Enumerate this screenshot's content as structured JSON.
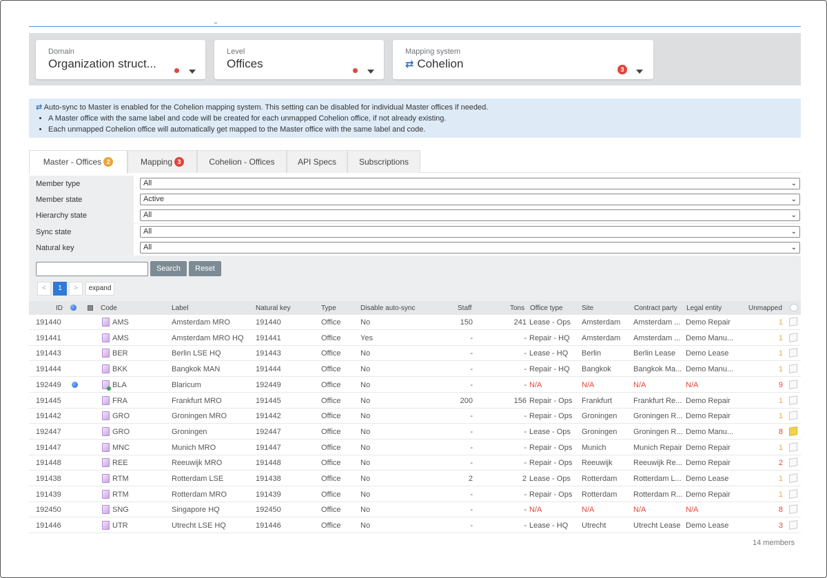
{
  "selectors": {
    "domain": {
      "label": "Domain",
      "value": "Organization struct..."
    },
    "level": {
      "label": "Level",
      "value": "Offices"
    },
    "mapping_system": {
      "label": "Mapping system",
      "value": "Cohelion",
      "badge": "3",
      "icon": "sync-icon"
    }
  },
  "info": {
    "line1": "Auto-sync to Master is enabled for the Cohelion mapping system. This setting can be disabled for individual Master offices if needed.",
    "bullets": [
      "A Master office with the same label and code will be created for each unmapped Cohelion office, if not already existing.",
      "Each unmapped Cohelion office will automatically get mapped to the Master office with the same label and code."
    ]
  },
  "tabs": [
    {
      "label": "Master - Offices",
      "badge": "2",
      "badge_color": "#e9a63c"
    },
    {
      "label": "Mapping",
      "badge": "3",
      "badge_color": "#e0453c"
    },
    {
      "label": "Cohelion - Offices"
    },
    {
      "label": "API Specs"
    },
    {
      "label": "Subscriptions"
    }
  ],
  "filters": [
    {
      "label": "Member type",
      "value": "All"
    },
    {
      "label": "Member state",
      "value": "Active"
    },
    {
      "label": "Hierarchy state",
      "value": "All"
    },
    {
      "label": "Sync state",
      "value": "All"
    },
    {
      "label": "Natural key",
      "value": "All"
    }
  ],
  "search": {
    "placeholder": "",
    "search_label": "Search",
    "reset_label": "Reset"
  },
  "pager": {
    "prev": "<",
    "page": "1",
    "next": ">",
    "expand": "expand"
  },
  "table": {
    "headers": {
      "id": "ID",
      "code": "Code",
      "label": "Label",
      "natural_key": "Natural key",
      "type": "Type",
      "disable_auto_sync": "Disable auto-sync",
      "staff": "Staff",
      "tons": "Tons",
      "office_type": "Office type",
      "site": "Site",
      "contract_party": "Contract party",
      "legal_entity": "Legal entity",
      "unmapped": "Unmapped"
    },
    "rows": [
      {
        "id": "191440",
        "code": "AMS",
        "label": "Amsterdam MRO",
        "natural_key": "191440",
        "type": "Office",
        "disable": "No",
        "staff": "150",
        "tons": "241",
        "office_type": "Lease - Ops",
        "site": "Amsterdam",
        "contract": "Amsterdam ...",
        "legal": "Demo Repair",
        "unmapped": "1"
      },
      {
        "id": "191441",
        "code": "AMS",
        "label": "Amsterdam MRO HQ",
        "natural_key": "191441",
        "type": "Office",
        "disable": "Yes",
        "staff": "-",
        "tons": "-",
        "office_type": "Repair - HQ",
        "site": "Amsterdam",
        "contract": "Amsterdam ...",
        "legal": "Demo Manu...",
        "unmapped": "1"
      },
      {
        "id": "191443",
        "code": "BER",
        "label": "Berlin LSE HQ",
        "natural_key": "191443",
        "type": "Office",
        "disable": "No",
        "staff": "-",
        "tons": "-",
        "office_type": "Lease - HQ",
        "site": "Berlin",
        "contract": "Berlin Lease",
        "legal": "Demo Lease",
        "unmapped": "1"
      },
      {
        "id": "191444",
        "code": "BKK",
        "label": "Bangkok MAN",
        "natural_key": "191444",
        "type": "Office",
        "disable": "No",
        "staff": "-",
        "tons": "-",
        "office_type": "Repair - HQ",
        "site": "Bangkok",
        "contract": "Bangkok Ma...",
        "legal": "Demo Manu...",
        "unmapped": "1"
      },
      {
        "id": "192449",
        "code": "BLA",
        "label": "Blaricum",
        "natural_key": "192449",
        "type": "Office",
        "disable": "No",
        "staff": "-",
        "tons": "-",
        "office_type": "N/A",
        "site": "N/A",
        "contract": "N/A",
        "legal": "N/A",
        "unmapped": "9",
        "blue_dot": true,
        "green": true,
        "na": true
      },
      {
        "id": "191445",
        "code": "FRA",
        "label": "Frankfurt MRO",
        "natural_key": "191445",
        "type": "Office",
        "disable": "No",
        "staff": "200",
        "tons": "156",
        "office_type": "Repair - Ops",
        "site": "Frankfurt",
        "contract": "Frankfurt Re...",
        "legal": "Demo Repair",
        "unmapped": "1"
      },
      {
        "id": "191442",
        "code": "GRO",
        "label": "Groningen MRO",
        "natural_key": "191442",
        "type": "Office",
        "disable": "No",
        "staff": "-",
        "tons": "-",
        "office_type": "Repair - Ops",
        "site": "Groningen",
        "contract": "Groningen R...",
        "legal": "Demo Repair",
        "unmapped": "1"
      },
      {
        "id": "192447",
        "code": "GRO",
        "label": "Groningen",
        "natural_key": "192447",
        "type": "Office",
        "disable": "No",
        "staff": "-",
        "tons": "-",
        "office_type": "Lease - Ops",
        "site": "Groningen",
        "contract": "Groningen R...",
        "legal": "Demo Manu...",
        "unmapped": "8",
        "note_filled": true
      },
      {
        "id": "191447",
        "code": "MNC",
        "label": "Munich MRO",
        "natural_key": "191447",
        "type": "Office",
        "disable": "No",
        "staff": "-",
        "tons": "-",
        "office_type": "Repair - Ops",
        "site": "Munich",
        "contract": "Munich Repair",
        "legal": "Demo Repair",
        "unmapped": "1"
      },
      {
        "id": "191448",
        "code": "REE",
        "label": "Reeuwijk MRO",
        "natural_key": "191448",
        "type": "Office",
        "disable": "No",
        "staff": "-",
        "tons": "-",
        "office_type": "Repair - Ops",
        "site": "Reeuwijk",
        "contract": "Reeuwijk Re...",
        "legal": "Demo Repair",
        "unmapped": "2"
      },
      {
        "id": "191438",
        "code": "RTM",
        "label": "Rotterdam LSE",
        "natural_key": "191438",
        "type": "Office",
        "disable": "No",
        "staff": "2",
        "tons": "2",
        "office_type": "Lease - Ops",
        "site": "Rotterdam",
        "contract": "Rotterdam L...",
        "legal": "Demo Lease",
        "unmapped": "1"
      },
      {
        "id": "191439",
        "code": "RTM",
        "label": "Rotterdam MRO",
        "natural_key": "191439",
        "type": "Office",
        "disable": "No",
        "staff": "-",
        "tons": "-",
        "office_type": "Repair - Ops",
        "site": "Rotterdam",
        "contract": "Rotterdam R...",
        "legal": "Demo Repair",
        "unmapped": "1"
      },
      {
        "id": "192450",
        "code": "SNG",
        "label": "Singapore HQ",
        "natural_key": "192450",
        "type": "Office",
        "disable": "No",
        "staff": "-",
        "tons": "-",
        "office_type": "N/A",
        "site": "N/A",
        "contract": "N/A",
        "legal": "N/A",
        "unmapped": "8",
        "na": true
      },
      {
        "id": "191446",
        "code": "UTR",
        "label": "Utrecht LSE HQ",
        "natural_key": "191446",
        "type": "Office",
        "disable": "No",
        "staff": "-",
        "tons": "-",
        "office_type": "Lease - HQ",
        "site": "Utrecht",
        "contract": "Utrecht Lease",
        "legal": "Demo Lease",
        "unmapped": "3"
      }
    ]
  },
  "footer": {
    "count": "14 members"
  }
}
